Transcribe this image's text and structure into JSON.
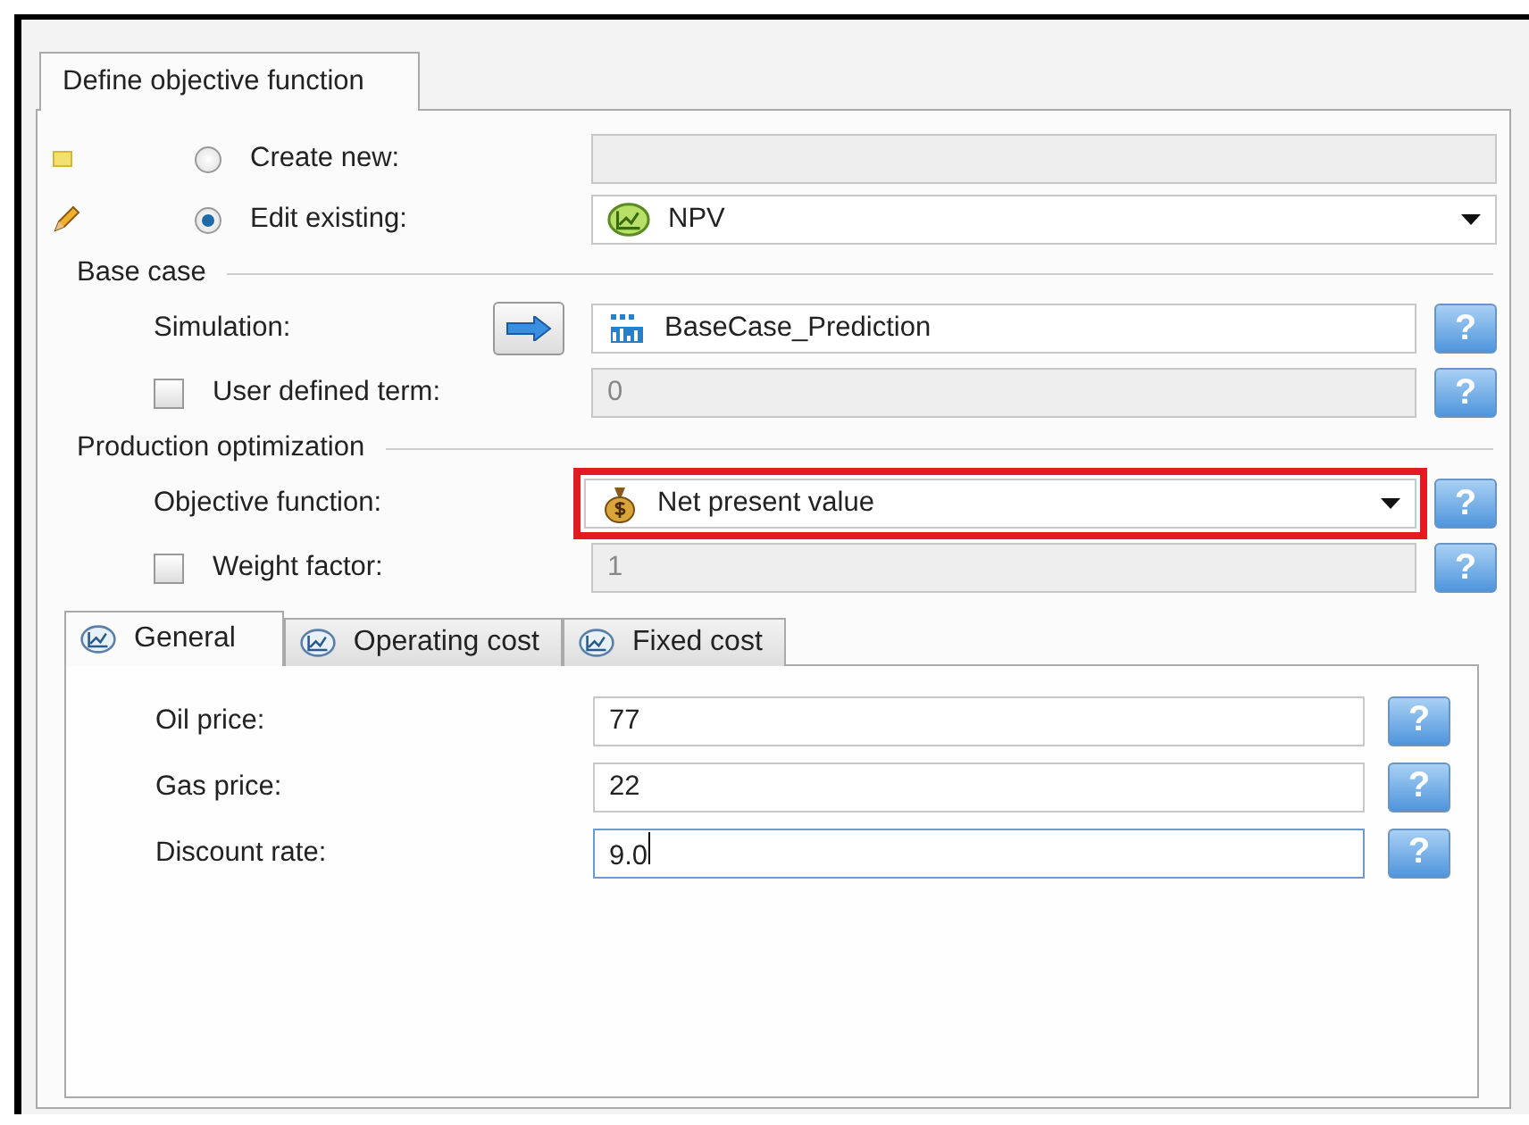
{
  "tab": {
    "label": "Define objective function",
    "selected": true
  },
  "mode_rows": [
    {
      "label": "Create new:",
      "selected": false,
      "field": {
        "kind": "blank",
        "disabled": true
      }
    },
    {
      "label": "Edit existing:",
      "selected": true,
      "field": {
        "kind": "dropdown",
        "value": "NPV",
        "disabled": false
      }
    }
  ],
  "sections": [
    {
      "title": "Base case",
      "rows": [
        {
          "kind": "link",
          "label": "Simulation:",
          "field": {
            "kind": "text",
            "value": "BaseCase_Prediction",
            "disabled": false
          },
          "help": "?"
        },
        {
          "kind": "check",
          "label": "User defined term:",
          "checked": false,
          "field": {
            "kind": "text",
            "value": "0",
            "disabled": true
          },
          "help": "?"
        }
      ]
    },
    {
      "title": "Production optimization",
      "rows": [
        {
          "kind": "plain",
          "label": "Objective function:",
          "field": {
            "kind": "dropdown",
            "value": "Net present value",
            "disabled": false,
            "highlighted": true
          },
          "help": "?"
        },
        {
          "kind": "check",
          "label": "Weight factor:",
          "checked": false,
          "field": {
            "kind": "text",
            "value": "1",
            "disabled": true
          },
          "help": "?"
        }
      ]
    }
  ],
  "inner_tabs": [
    {
      "label": "General",
      "selected": true
    },
    {
      "label": "Operating cost",
      "selected": false
    },
    {
      "label": "Fixed cost",
      "selected": false
    }
  ],
  "params": [
    {
      "label": "Oil price:",
      "value": "77",
      "focused": false,
      "help": "?"
    },
    {
      "label": "Gas price:",
      "value": "22",
      "focused": false,
      "help": "?"
    },
    {
      "label": "Discount rate:",
      "value": "9.0",
      "focused": true,
      "help": "?"
    }
  ]
}
